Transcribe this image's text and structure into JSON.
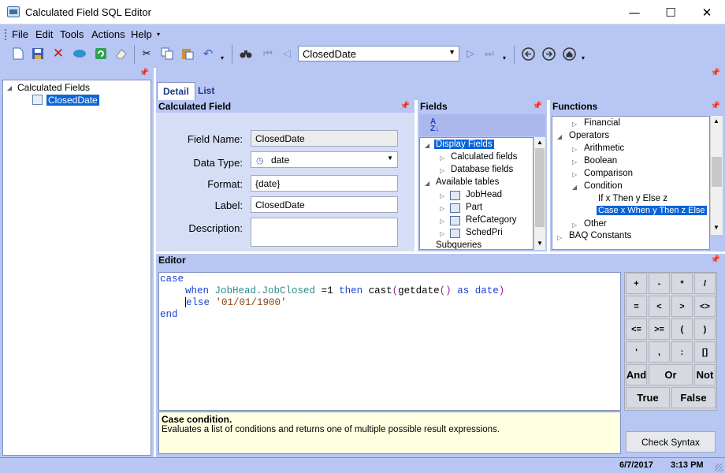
{
  "window": {
    "title": "Calculated Field SQL Editor",
    "min_glyph": "—",
    "max_glyph": "☐",
    "close_glyph": "✕"
  },
  "menu": [
    "File",
    "Edit",
    "Tools",
    "Actions",
    "Help"
  ],
  "toolbar": {
    "nav_value": "ClosedDate"
  },
  "tree": {
    "root": "Calculated Fields",
    "child": "ClosedDate"
  },
  "tabs": [
    "Detail",
    "List"
  ],
  "calculated_field": {
    "header": "Calculated Field",
    "field_name_label": "Field Name:",
    "field_name": "ClosedDate",
    "data_type_label": "Data Type:",
    "data_type": "date",
    "format_label": "Format:",
    "format": "{date}",
    "label_label": "Label:",
    "label": "ClosedDate",
    "description_label": "Description:"
  },
  "fields": {
    "header": "Fields",
    "sort_glyph": "A↓Z",
    "items": [
      "Display Fields",
      "Calculated fields",
      "Database fields",
      "Available tables",
      "JobHead",
      "Part",
      "RefCategory",
      "SchedPri",
      "Subqueries"
    ]
  },
  "functions": {
    "header": "Functions",
    "items": [
      "Financial",
      "Operators",
      "Arithmetic",
      "Boolean",
      "Comparison",
      "Condition",
      "If x Then y Else z",
      "Case x When y Then z Else",
      "Other",
      "BAQ Constants"
    ]
  },
  "editor": {
    "header": "Editor",
    "code": {
      "l1": "case",
      "when": "when",
      "col": "JobHead.JobClosed",
      "eq": " =1 ",
      "then": "then",
      "cast": "cast",
      "getdate": "getdate",
      "parens": "()",
      "as": "as",
      "date": "date",
      "else": "else",
      "lit": "'01/01/1900'",
      "end": "end"
    },
    "help_title": "Case condition.",
    "help_text": "Evaluates a list of conditions and returns one of multiple possible result expressions."
  },
  "operators": [
    "+",
    "-",
    "*",
    "/",
    "=",
    "<",
    ">",
    "<>",
    "<=",
    ">=",
    "(",
    ")",
    "'",
    ",",
    ":",
    "[]",
    "And",
    "Or",
    "Not",
    "True",
    "False"
  ],
  "check_syntax": "Check Syntax",
  "status": {
    "date": "6/7/2017",
    "time": "3:13 PM"
  }
}
